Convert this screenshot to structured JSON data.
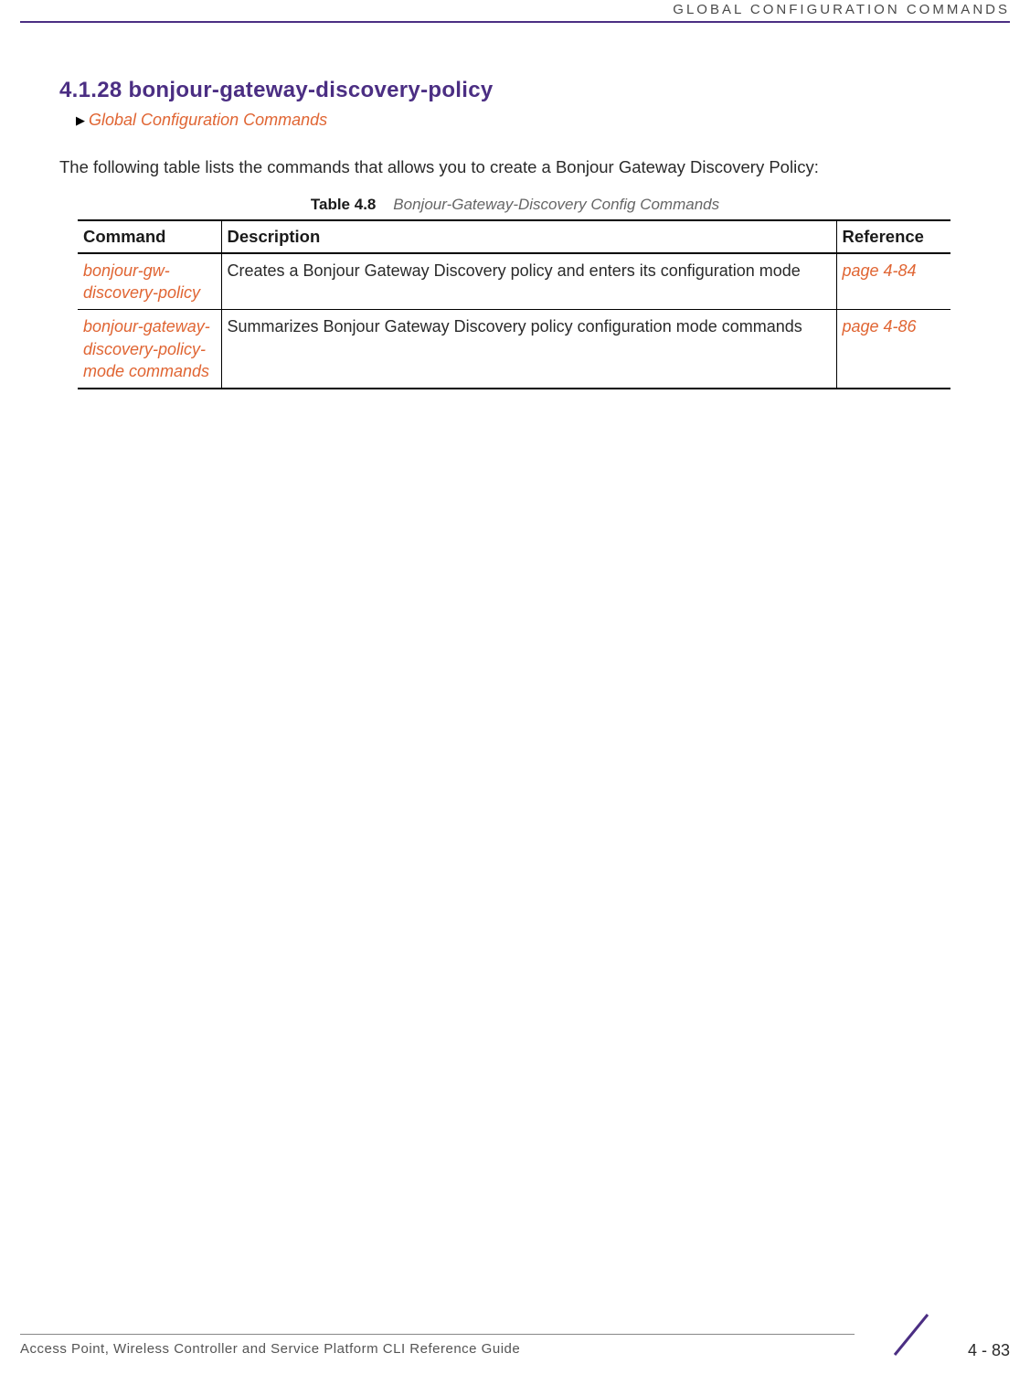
{
  "header": {
    "chapter_title": "GLOBAL CONFIGURATION COMMANDS"
  },
  "section": {
    "heading": "4.1.28 bonjour-gateway-discovery-policy",
    "breadcrumb_link": "Global Configuration Commands",
    "intro": "The following table lists the commands that allows you to create a Bonjour Gateway Discovery Policy:"
  },
  "table": {
    "caption_label": "Table 4.8",
    "caption_title": "Bonjour-Gateway-Discovery Config Commands",
    "headers": {
      "command": "Command",
      "description": "Description",
      "reference": "Reference"
    },
    "rows": [
      {
        "command": "bonjour-gw-discovery-policy",
        "description": "Creates a Bonjour Gateway Discovery policy and enters its configuration mode",
        "reference": "page 4-84"
      },
      {
        "command": "bonjour-gateway-discovery-policy-mode commands",
        "description": "Summarizes Bonjour Gateway Discovery policy configuration mode commands",
        "reference": "page 4-86"
      }
    ]
  },
  "footer": {
    "guide_title": "Access Point, Wireless Controller and Service Platform CLI Reference Guide",
    "page_number": "4 - 83"
  },
  "colors": {
    "accent_purple": "#4b2e83",
    "link_orange": "#e06533"
  }
}
